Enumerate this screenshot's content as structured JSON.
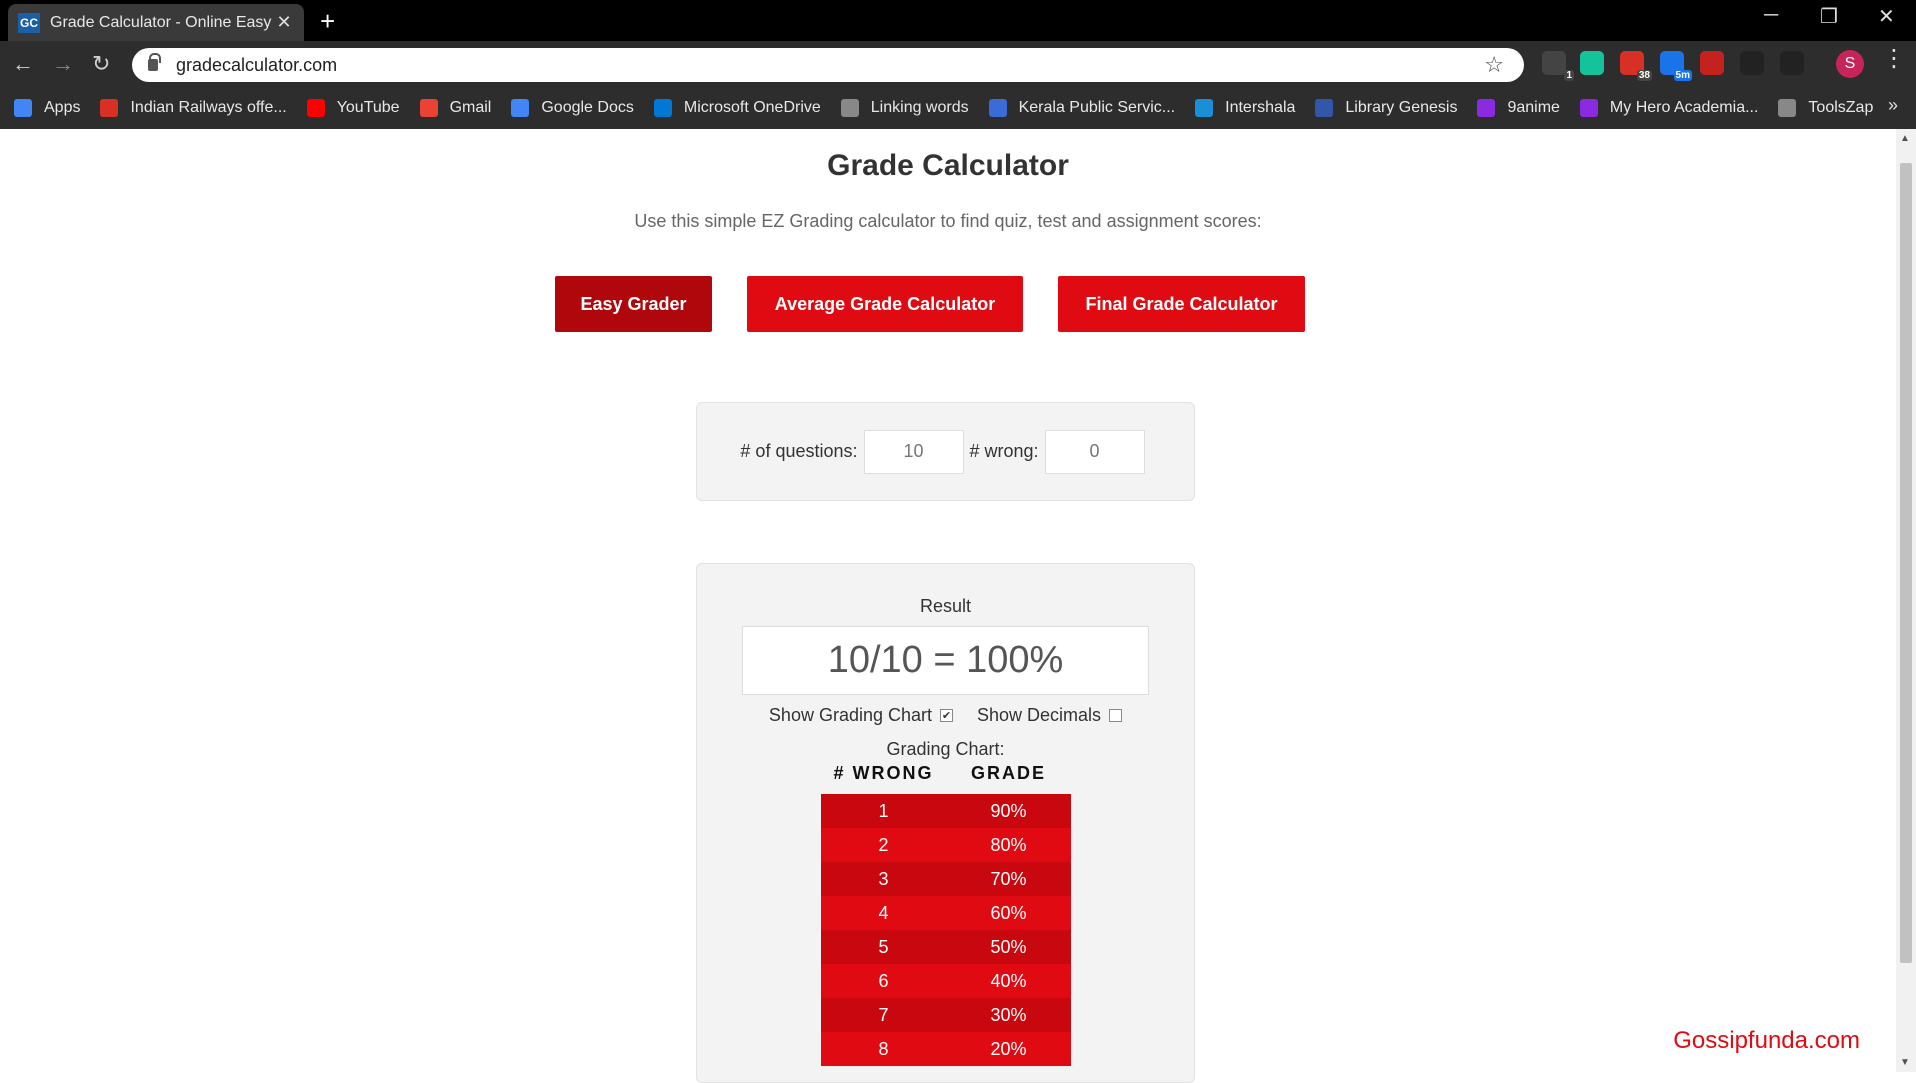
{
  "browser": {
    "tab_title": "Grade Calculator - Online Easy Gr",
    "tab_favicon": "GC",
    "url": "gradecalculator.com",
    "new_tab": "+",
    "minimize": "─",
    "restore": "❐",
    "close": "✕",
    "profile_initial": "S",
    "extensions": [
      {
        "name": "mail-checker-icon",
        "badge": "1",
        "color": "#444"
      },
      {
        "name": "grammarly-icon",
        "badge": "",
        "color": "#15c39a"
      },
      {
        "name": "notification-icon",
        "badge": "38",
        "color": "#d93025"
      },
      {
        "name": "timer-icon",
        "badge": "5m",
        "color": "#1a73e8"
      },
      {
        "name": "pdf-icon",
        "badge": "",
        "color": "#c5221f"
      },
      {
        "name": "bolt-icon",
        "badge": "",
        "color": "#222"
      },
      {
        "name": "bolt-alt-icon",
        "badge": "",
        "color": "#222"
      }
    ]
  },
  "bookmarks": [
    {
      "label": "Apps",
      "icon": "apps-grid-icon",
      "color": "#4285f4"
    },
    {
      "label": "Indian Railways offe...",
      "icon": "railways-icon",
      "color": "#d93025"
    },
    {
      "label": "YouTube",
      "icon": "youtube-icon",
      "color": "#ff0000"
    },
    {
      "label": "Gmail",
      "icon": "gmail-icon",
      "color": "#ea4335"
    },
    {
      "label": "Google Docs",
      "icon": "docs-icon",
      "color": "#4285f4"
    },
    {
      "label": "Microsoft OneDrive",
      "icon": "onedrive-icon",
      "color": "#0078d4"
    },
    {
      "label": "Linking words",
      "icon": "globe-icon",
      "color": "#888"
    },
    {
      "label": "Kerala Public Servic...",
      "icon": "kpsc-icon",
      "color": "#3b6bd6"
    },
    {
      "label": "Intershala",
      "icon": "internshala-icon",
      "color": "#1a8fd6"
    },
    {
      "label": "Library Genesis",
      "icon": "library-icon",
      "color": "#3355aa"
    },
    {
      "label": "9anime",
      "icon": "play-icon",
      "color": "#8a2be2"
    },
    {
      "label": "My Hero Academia...",
      "icon": "play-icon",
      "color": "#8a2be2"
    },
    {
      "label": "ToolsZap",
      "icon": "globe-icon",
      "color": "#888"
    }
  ],
  "bookmarks_more": "»",
  "page": {
    "title": "Grade Calculator",
    "subtitle": "Use this simple EZ Grading calculator to find quiz, test and assignment scores:",
    "buttons": {
      "easy_grader": "Easy Grader",
      "average": "Average Grade Calculator",
      "final": "Final Grade Calculator"
    },
    "inputs": {
      "questions_label": "# of questions:",
      "questions_value": "10",
      "wrong_label": "# wrong:",
      "wrong_value": "0"
    },
    "result": {
      "label": "Result",
      "value": "10/10 = 100%",
      "show_chart_label": "Show Grading Chart",
      "show_chart_checked": true,
      "show_decimals_label": "Show Decimals",
      "show_decimals_checked": false,
      "chart_title": "Grading Chart:",
      "col_wrong": "# WRONG",
      "col_grade": "GRADE"
    },
    "grading_rows": [
      {
        "wrong": "1",
        "grade": "90%"
      },
      {
        "wrong": "2",
        "grade": "80%"
      },
      {
        "wrong": "3",
        "grade": "70%"
      },
      {
        "wrong": "4",
        "grade": "60%"
      },
      {
        "wrong": "5",
        "grade": "50%"
      },
      {
        "wrong": "6",
        "grade": "40%"
      },
      {
        "wrong": "7",
        "grade": "30%"
      },
      {
        "wrong": "8",
        "grade": "20%"
      }
    ],
    "watermark": "Gossipfunda.com"
  },
  "colors": {
    "accent_red": "#e00b12",
    "active_red": "#b0070d",
    "row_red": "#c8080e"
  }
}
